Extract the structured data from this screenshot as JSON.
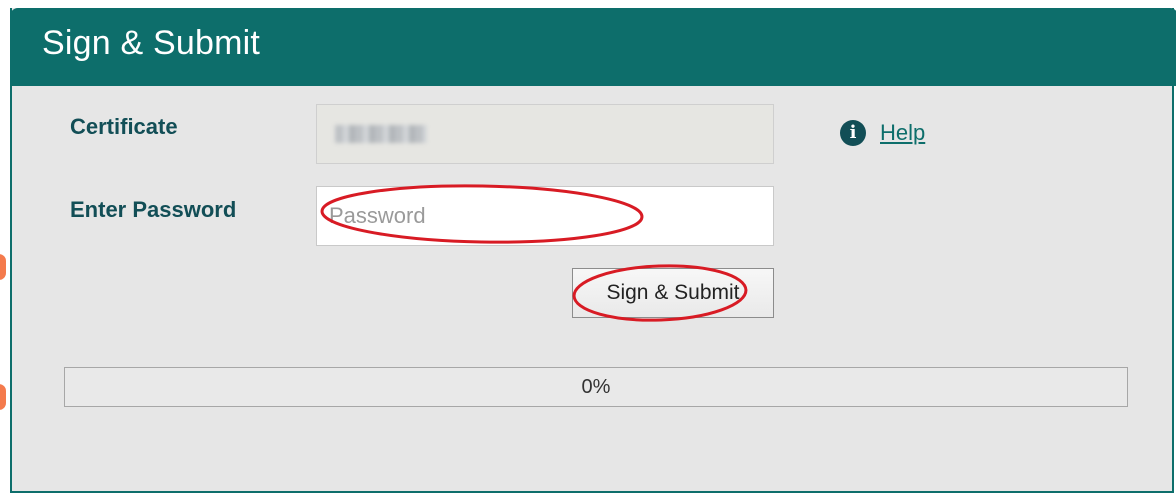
{
  "dialog": {
    "title": "Sign & Submit",
    "certificate_label": "Certificate",
    "certificate_value": "",
    "help_label": "Help",
    "password_label": "Enter Password",
    "password_placeholder": "Password",
    "password_value": "",
    "submit_label": "Sign & Submit",
    "progress_text": "0%",
    "progress_fraction": 0
  },
  "icons": {
    "info": "info-icon"
  },
  "colors": {
    "header": "#0d6e6b",
    "label": "#124e56",
    "annotation": "#d81b24",
    "side_marks": "#f47a4c"
  }
}
